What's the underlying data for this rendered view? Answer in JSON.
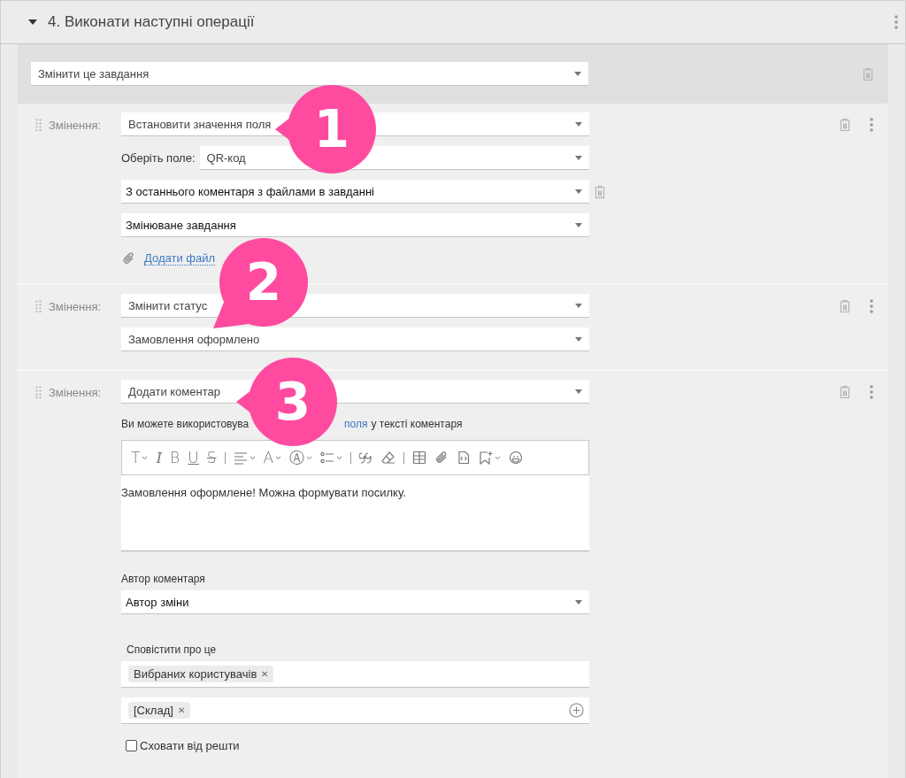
{
  "section": {
    "title": "4. Виконати наступні операції",
    "expanded": true
  },
  "target": {
    "value": "Змінити це завдання"
  },
  "actions": [
    {
      "kind": "set_field",
      "label": "Змінення:",
      "type": "Встановити значення поля",
      "field_label": "Оберіть поле:",
      "field": "QR-код",
      "source": "З останнього коментаря з файлами в завданні",
      "task": "Змінюване завдання",
      "attach_link": "Додати файл"
    },
    {
      "kind": "status",
      "label": "Змінення:",
      "type": "Змінити статус",
      "status": "Замовлення оформлено"
    },
    {
      "kind": "comment",
      "label": "Змінення:",
      "type": "Додати коментар",
      "hint_before": "Ви можете використовува",
      "hint_link": "поля",
      "hint_after": "у тексті коментаря",
      "toolbar": [
        {
          "kind": "size",
          "glyph": "T",
          "dropdown": true
        },
        {
          "kind": "italic",
          "glyph": "I",
          "dropdown": false
        },
        {
          "kind": "bold",
          "glyph": "B",
          "dropdown": false
        },
        {
          "kind": "underline",
          "glyph": "U",
          "dropdown": false
        },
        {
          "kind": "strike",
          "glyph": "S",
          "dropdown": false
        },
        {
          "kind": "separator"
        },
        {
          "kind": "align",
          "dropdown": true
        },
        {
          "kind": "color",
          "glyph": "A",
          "dropdown": true
        },
        {
          "kind": "highlight",
          "glyph": "Ⓐ",
          "dropdown": true
        },
        {
          "kind": "list",
          "dropdown": true
        },
        {
          "kind": "separator"
        },
        {
          "kind": "quote",
          "dropdown": false
        },
        {
          "kind": "eraser",
          "dropdown": false
        },
        {
          "kind": "separator"
        },
        {
          "kind": "table",
          "dropdown": false
        },
        {
          "kind": "attach",
          "dropdown": false
        },
        {
          "kind": "code",
          "dropdown": false
        },
        {
          "kind": "bookmark",
          "dropdown": true
        },
        {
          "kind": "emoji",
          "dropdown": false
        }
      ],
      "body": "Замовлення оформлене! Можна формувати посилку.",
      "author_label": "Автор коментаря",
      "author": "Автор зміни",
      "notify_label": "Сповістити про це",
      "notify_tags": [
        {
          "text": "Вибраних користувачів",
          "remove": "✕"
        }
      ],
      "recipient_tags": [
        {
          "text": "[Склад]",
          "remove": "✕"
        }
      ],
      "hide_label": "Сховати від решти",
      "hide_checked": false
    }
  ],
  "callouts": [
    {
      "number": "1"
    },
    {
      "number": "2"
    },
    {
      "number": "3"
    }
  ]
}
